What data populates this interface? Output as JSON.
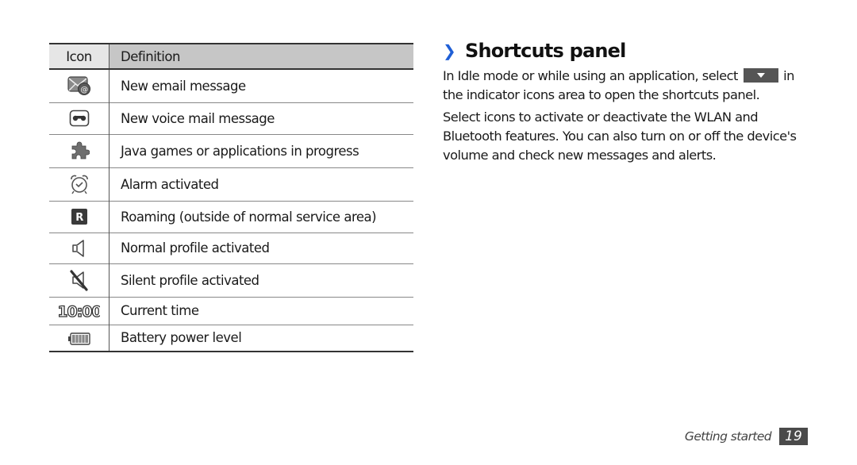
{
  "table": {
    "headers": {
      "icon": "Icon",
      "definition": "Definition"
    },
    "rows": [
      {
        "icon": "new-email-icon",
        "definition": "New email message"
      },
      {
        "icon": "voicemail-icon",
        "definition": "New voice mail message"
      },
      {
        "icon": "java-puzzle-icon",
        "definition": "Java games or applications in progress"
      },
      {
        "icon": "alarm-clock-icon",
        "definition": "Alarm activated"
      },
      {
        "icon": "roaming-icon",
        "definition": "Roaming (outside of normal service area)",
        "glyph": "R"
      },
      {
        "icon": "speaker-icon",
        "definition": "Normal profile activated"
      },
      {
        "icon": "speaker-muted-icon",
        "definition": "Silent profile activated"
      },
      {
        "icon": "clock-digits-icon",
        "definition": "Current time",
        "glyph": "10:00"
      },
      {
        "icon": "battery-icon",
        "definition": "Battery power level"
      }
    ]
  },
  "section": {
    "chevron": "❯",
    "title": "Shortcuts panel",
    "para1_before": "In Idle mode or while using an application, select",
    "para1_after": "in the indicator icons area to open the shortcuts panel.",
    "para2": "Select icons to activate or deactivate the WLAN and Bluetooth features. You can also turn on or off the device's volume and check new messages and alerts."
  },
  "footer": {
    "label": "Getting started",
    "page": "19"
  },
  "colors": {
    "accent": "#1f5fd6",
    "header_icon_bg": "#e6e6e6",
    "header_def_bg": "#c6c6c6",
    "page_badge": "#4a4a4a"
  }
}
